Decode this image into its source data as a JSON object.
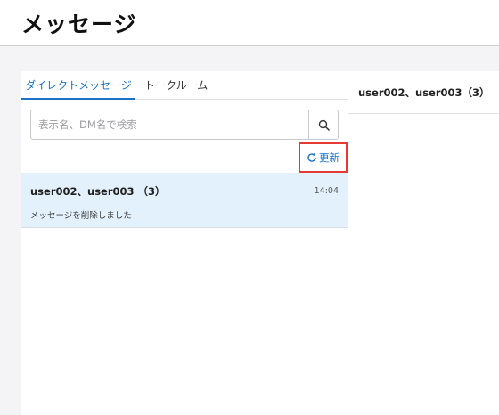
{
  "page": {
    "title": "メッセージ"
  },
  "tabs": [
    {
      "label": "ダイレクトメッセージ",
      "active": true
    },
    {
      "label": "トークルーム",
      "active": false
    }
  ],
  "search": {
    "placeholder": "表示名、DM名で検索",
    "value": "",
    "icon": "search-icon"
  },
  "refresh": {
    "label": "更新",
    "icon": "refresh-icon",
    "highlight_color": "#e53935"
  },
  "conversations": [
    {
      "name": "user002、user003 （3）",
      "time": "14:04",
      "preview": "メッセージを削除しました",
      "selected": true
    }
  ],
  "detail": {
    "title": "user002、user003（3）"
  },
  "colors": {
    "accent": "#1a73c9",
    "selected_row": "#e3f1fc",
    "background": "#f4f4f6"
  }
}
